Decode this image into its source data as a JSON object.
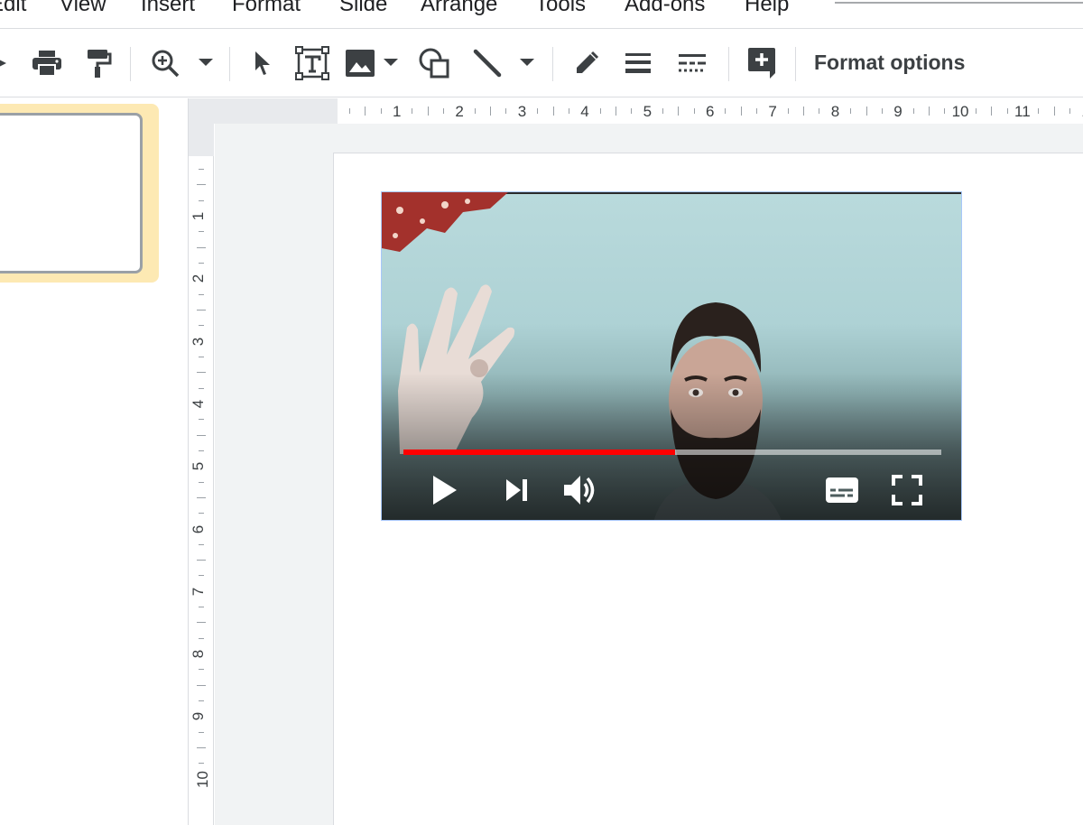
{
  "menu": {
    "items": [
      "Edit",
      "View",
      "Insert",
      "Format",
      "Slide",
      "Arrange",
      "Tools",
      "Add-ons",
      "Help"
    ]
  },
  "toolbar": {
    "icons": [
      "paint-format-partial-icon",
      "print-icon",
      "paint-roller-icon",
      "zoom-icon",
      "dropdown-arrow-icon",
      "select-cursor-icon",
      "text-box-icon",
      "image-icon",
      "dropdown-arrow-icon",
      "shape-icon",
      "line-icon",
      "dropdown-arrow-icon",
      "pen-icon",
      "line-weight-icon",
      "line-dash-icon",
      "add-comment-icon"
    ],
    "format_options_label": "Format options"
  },
  "ruler": {
    "horizontal_labels": [
      "1",
      "2",
      "3",
      "4",
      "5",
      "6",
      "7",
      "8",
      "9",
      "10",
      "11",
      "1"
    ],
    "vertical_labels": [
      "1",
      "2",
      "3",
      "4",
      "5",
      "6",
      "7",
      "8",
      "9",
      "10"
    ]
  },
  "video": {
    "progress": 0.505,
    "progress_color": "#ff0000",
    "controls": [
      "play-icon",
      "next-icon",
      "volume-icon",
      "subtitles-icon",
      "fullscreen-icon"
    ]
  },
  "colors": {
    "selection_highlight": "#fde9b3",
    "accent_border": "#a8c7fa"
  }
}
